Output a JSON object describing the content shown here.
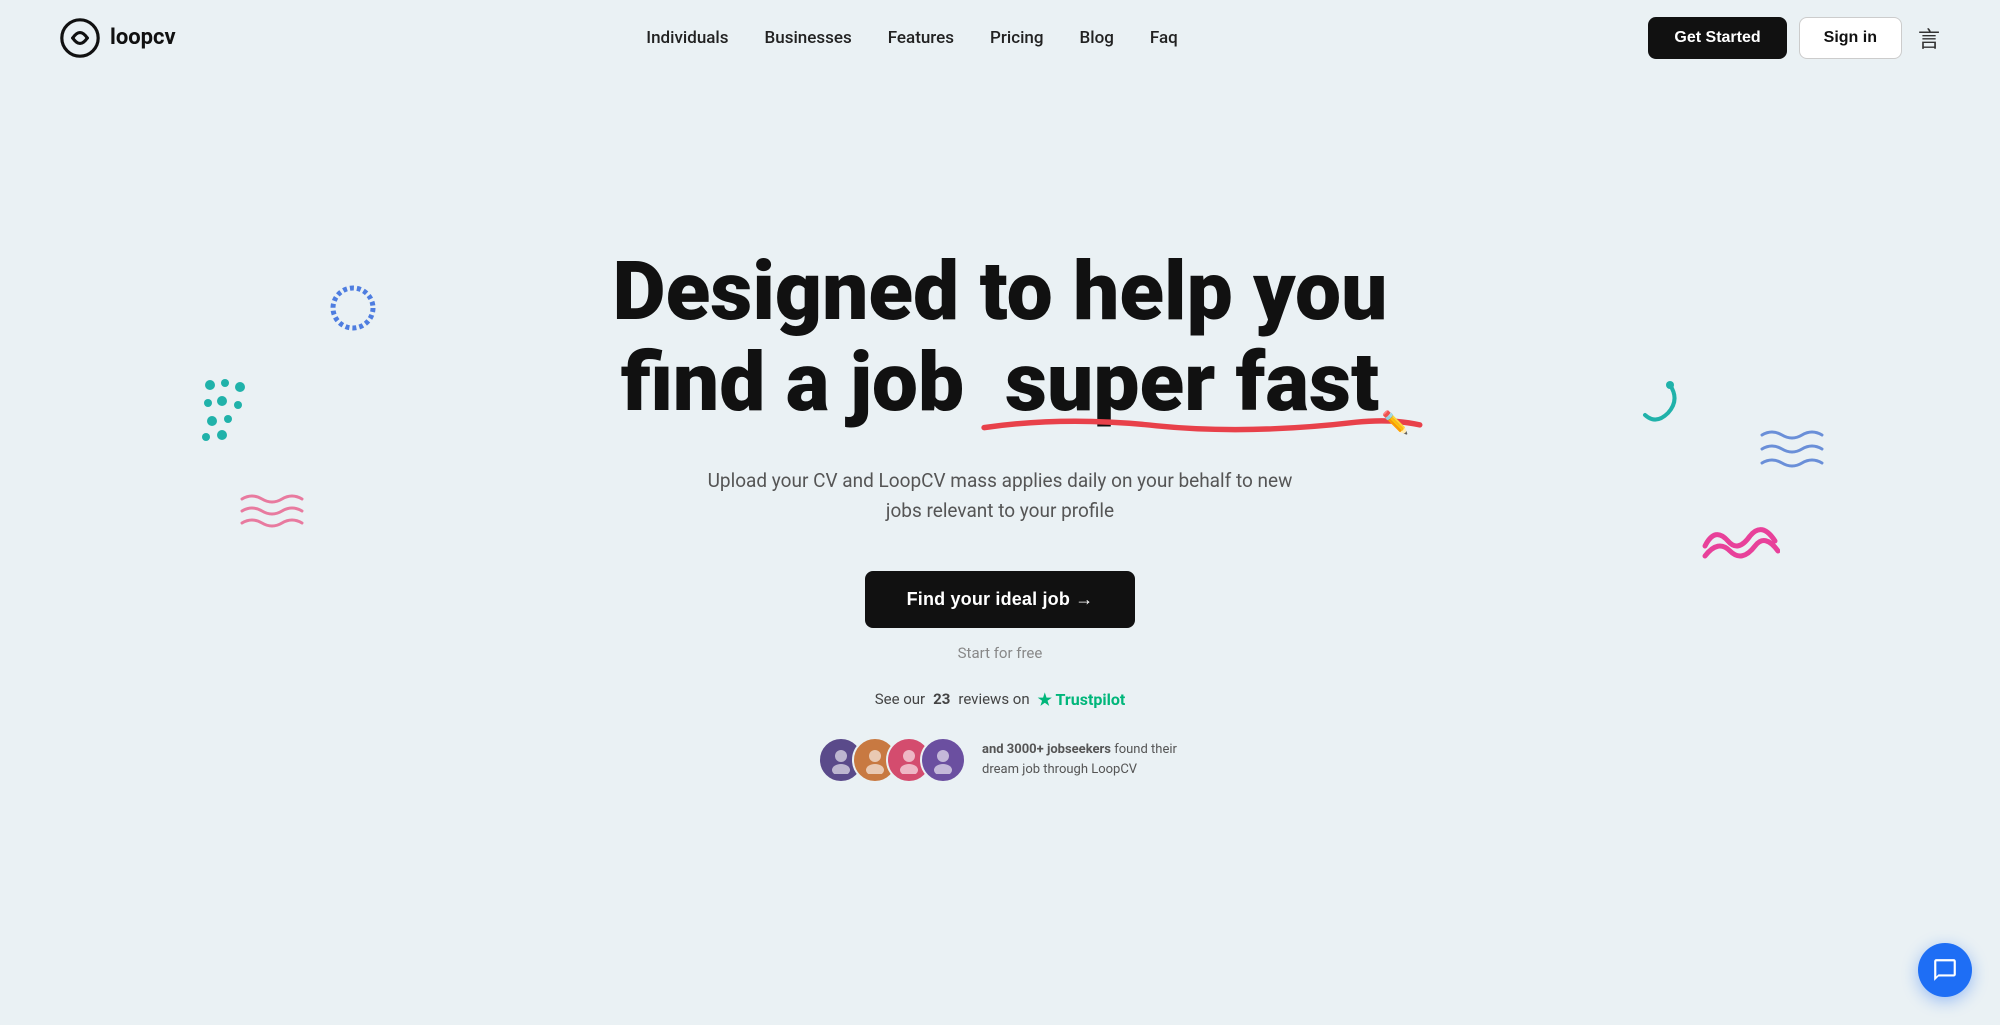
{
  "nav": {
    "logo_text": "loopcv",
    "links": [
      {
        "label": "Individuals",
        "href": "#"
      },
      {
        "label": "Businesses",
        "href": "#"
      },
      {
        "label": "Features",
        "href": "#"
      },
      {
        "label": "Pricing",
        "href": "#"
      },
      {
        "label": "Blog",
        "href": "#"
      },
      {
        "label": "Faq",
        "href": "#"
      }
    ],
    "get_started": "Get Started",
    "sign_in": "Sign in"
  },
  "hero": {
    "title_line1": "Designed to help you",
    "title_line2_before": "find a job",
    "title_line2_after": "super fast",
    "subtitle": "Upload your CV and LoopCV mass applies daily on your behalf to new jobs relevant to your profile",
    "cta_button": "Find your ideal job →",
    "start_free": "Start for free",
    "trustpilot_text_before": "See our",
    "trustpilot_count": "23",
    "trustpilot_text_after": "reviews on",
    "trustpilot_brand": "★ Trustpilot",
    "social_proof_text": "and 3000+ jobseekers found their dream job through LoopCV"
  },
  "avatars": [
    {
      "color": "#5a4a8a",
      "initials": ""
    },
    {
      "color": "#c87941",
      "initials": ""
    },
    {
      "color": "#d44c6e",
      "initials": ""
    },
    {
      "color": "#6b4fa0",
      "initials": ""
    }
  ]
}
